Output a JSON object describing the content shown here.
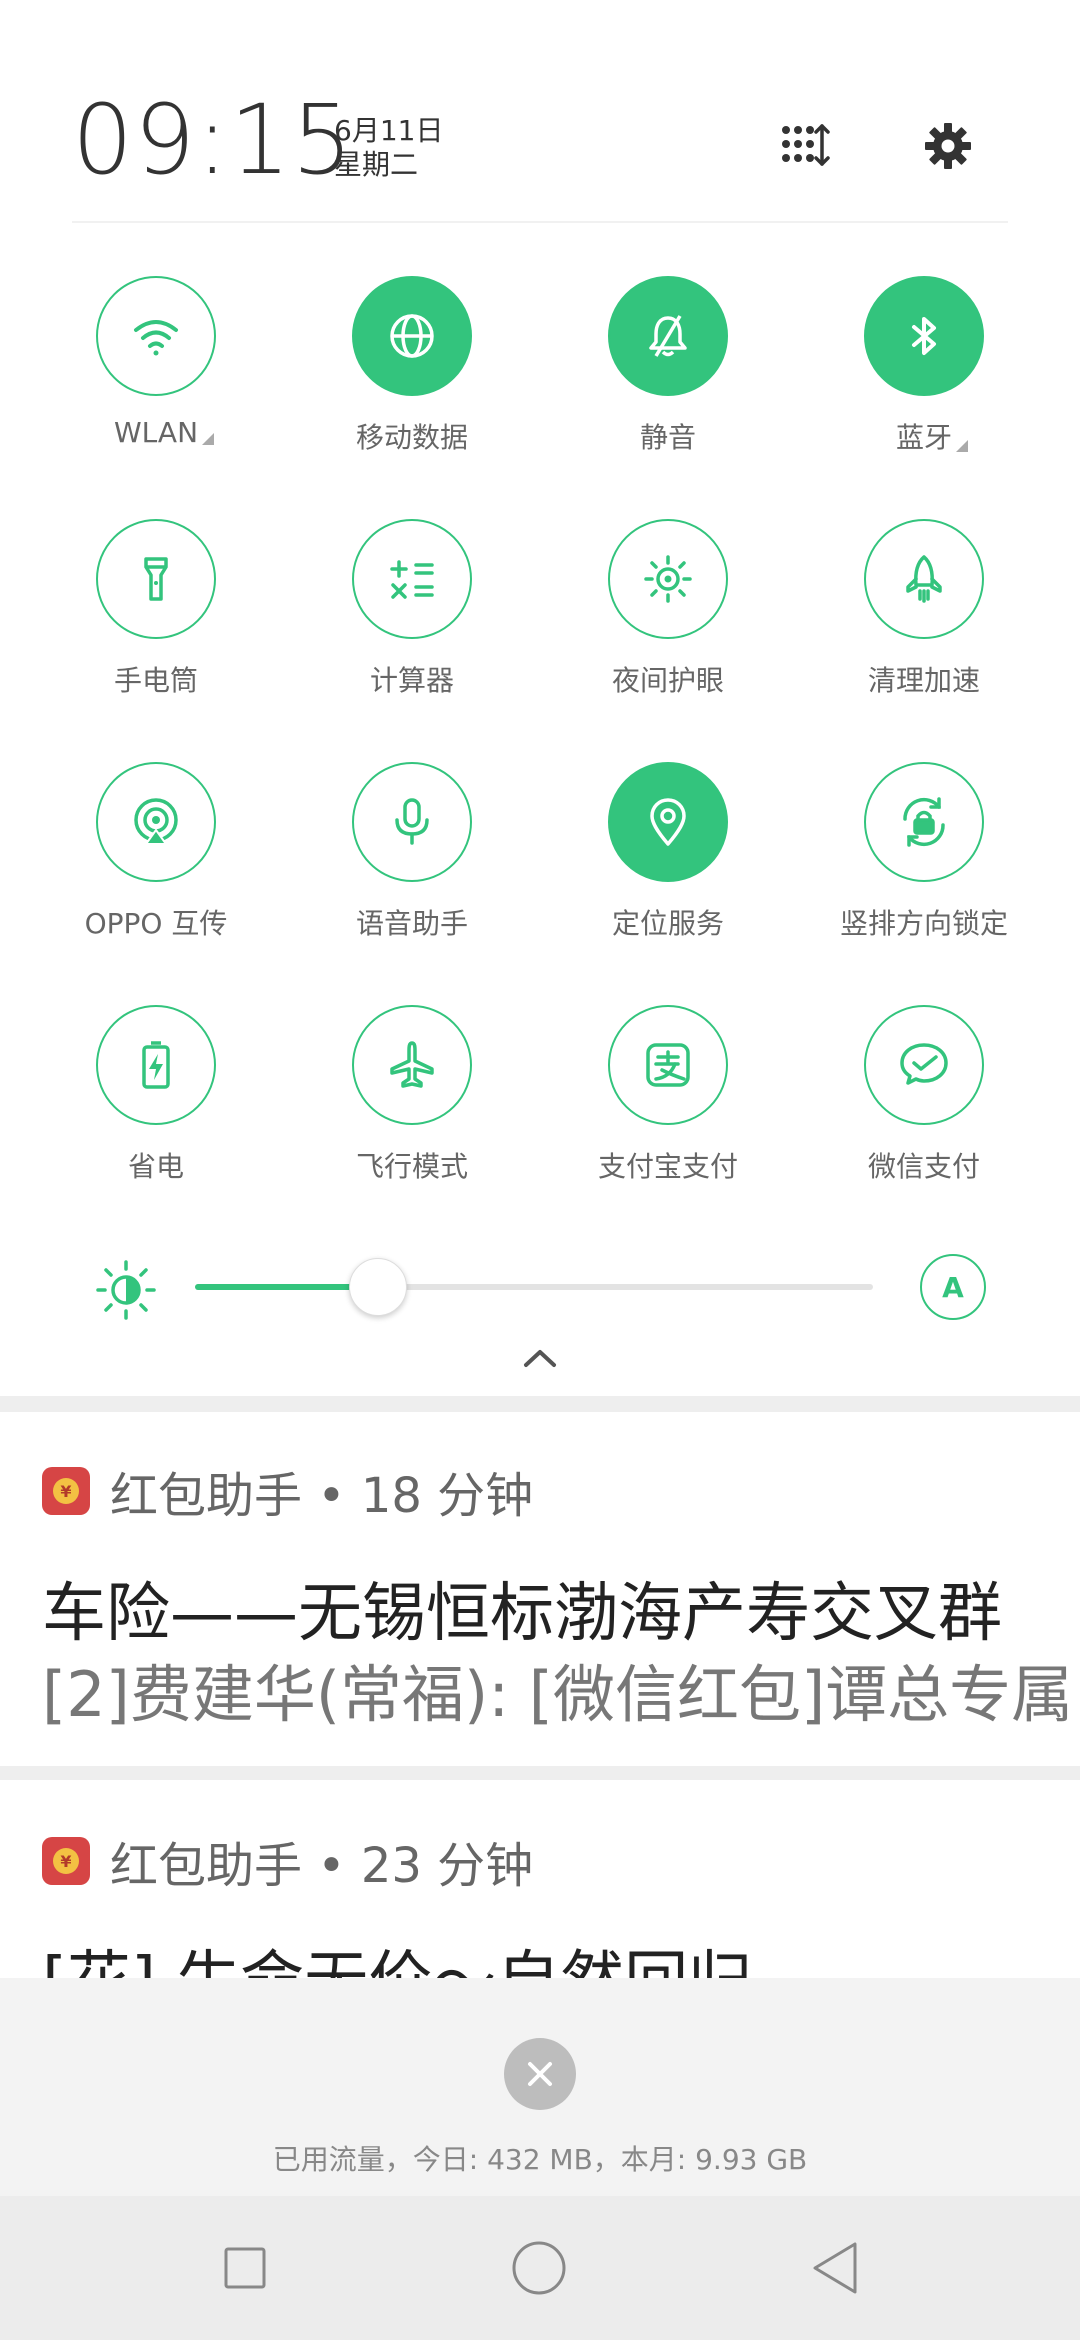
{
  "header": {
    "time": "09:15",
    "date": "6月11日",
    "weekday": "星期二"
  },
  "toggles": [
    [
      {
        "label": "WLAN",
        "icon": "wifi-icon",
        "on": false,
        "has_more": true
      },
      {
        "label": "移动数据",
        "icon": "globe-icon",
        "on": true,
        "has_more": false
      },
      {
        "label": "静音",
        "icon": "bell-off-icon",
        "on": true,
        "has_more": false
      },
      {
        "label": "蓝牙",
        "icon": "bluetooth-icon",
        "on": true,
        "has_more": true
      }
    ],
    [
      {
        "label": "手电筒",
        "icon": "flashlight-icon",
        "on": false
      },
      {
        "label": "计算器",
        "icon": "calculator-icon",
        "on": false
      },
      {
        "label": "夜间护眼",
        "icon": "eye-care-icon",
        "on": false
      },
      {
        "label": "清理加速",
        "icon": "rocket-icon",
        "on": false
      }
    ],
    [
      {
        "label": "OPPO 互传",
        "icon": "share-icon",
        "on": false
      },
      {
        "label": "语音助手",
        "icon": "microphone-icon",
        "on": false
      },
      {
        "label": "定位服务",
        "icon": "location-icon",
        "on": true
      },
      {
        "label": "竖排方向锁定",
        "icon": "rotation-lock-icon",
        "on": false
      }
    ],
    [
      {
        "label": "省电",
        "icon": "battery-saver-icon",
        "on": false
      },
      {
        "label": "飞行模式",
        "icon": "airplane-icon",
        "on": false
      },
      {
        "label": "支付宝支付",
        "icon": "alipay-icon",
        "on": false
      },
      {
        "label": "微信支付",
        "icon": "wechat-pay-icon",
        "on": false
      }
    ]
  ],
  "brightness": {
    "level": 0.27,
    "auto_label": "A"
  },
  "notifications": [
    {
      "app": "红包助手",
      "meta": "红包助手 • 18 分钟",
      "title": "车险——无锡恒标渤海产寿交叉群",
      "body": "[2]费建华(常福): [微信红包]谭总专属"
    },
    {
      "app": "红包助手",
      "meta": "红包助手 • 23 分钟",
      "title": "[花] 生命无价～自然回归",
      "body": ""
    }
  ],
  "footer": {
    "traffic": "已用流量，今日: 432 MB，本月: 9.93 GB"
  },
  "colors": {
    "accent": "#33c47d",
    "app_icon": "#d64545"
  }
}
